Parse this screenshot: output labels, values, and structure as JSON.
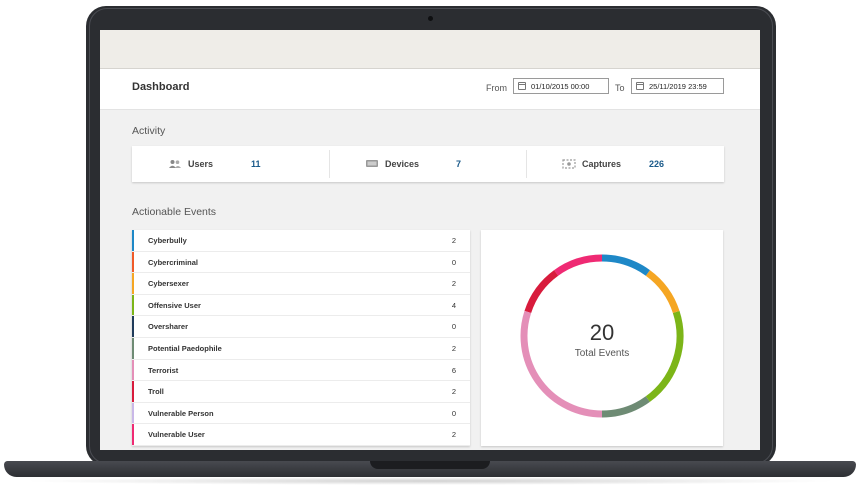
{
  "header": {
    "title": "Dashboard",
    "from_label": "From",
    "from_value": "01/10/2015 00:00",
    "to_label": "To",
    "to_value": "25/11/2019 23:59"
  },
  "activity": {
    "title": "Activity",
    "items": [
      {
        "label": "Users",
        "value": "11",
        "icon": "users-icon"
      },
      {
        "label": "Devices",
        "value": "7",
        "icon": "devices-icon"
      },
      {
        "label": "Captures",
        "value": "226",
        "icon": "captures-icon"
      }
    ]
  },
  "events": {
    "title": "Actionable Events",
    "rows": [
      {
        "name": "Cyberbully",
        "count": "2",
        "color": "#1e88c7"
      },
      {
        "name": "Cybercriminal",
        "count": "0",
        "color": "#f05a28"
      },
      {
        "name": "Cybersexer",
        "count": "2",
        "color": "#f5a623"
      },
      {
        "name": "Offensive User",
        "count": "4",
        "color": "#7cb518"
      },
      {
        "name": "Oversharer",
        "count": "0",
        "color": "#1f3b5a"
      },
      {
        "name": "Potential Paedophile",
        "count": "2",
        "color": "#6e8b74"
      },
      {
        "name": "Terrorist",
        "count": "6",
        "color": "#e48fb8"
      },
      {
        "name": "Troll",
        "count": "2",
        "color": "#d81b3c"
      },
      {
        "name": "Vulnerable Person",
        "count": "0",
        "color": "#c9b8e8"
      },
      {
        "name": "Vulnerable User",
        "count": "2",
        "color": "#ef2a73"
      }
    ]
  },
  "summary": {
    "total": "20",
    "total_label": "Total Events"
  },
  "chart_data": {
    "type": "pie",
    "categories": [
      "Cyberbully",
      "Cybercriminal",
      "Cybersexer",
      "Offensive User",
      "Oversharer",
      "Potential Paedophile",
      "Terrorist",
      "Troll",
      "Vulnerable Person",
      "Vulnerable User"
    ],
    "values": [
      2,
      0,
      2,
      4,
      0,
      2,
      6,
      2,
      0,
      2
    ],
    "colors": [
      "#1e88c7",
      "#f05a28",
      "#f5a623",
      "#7cb518",
      "#1f3b5a",
      "#6e8b74",
      "#e48fb8",
      "#d81b3c",
      "#c9b8e8",
      "#ef2a73"
    ]
  }
}
